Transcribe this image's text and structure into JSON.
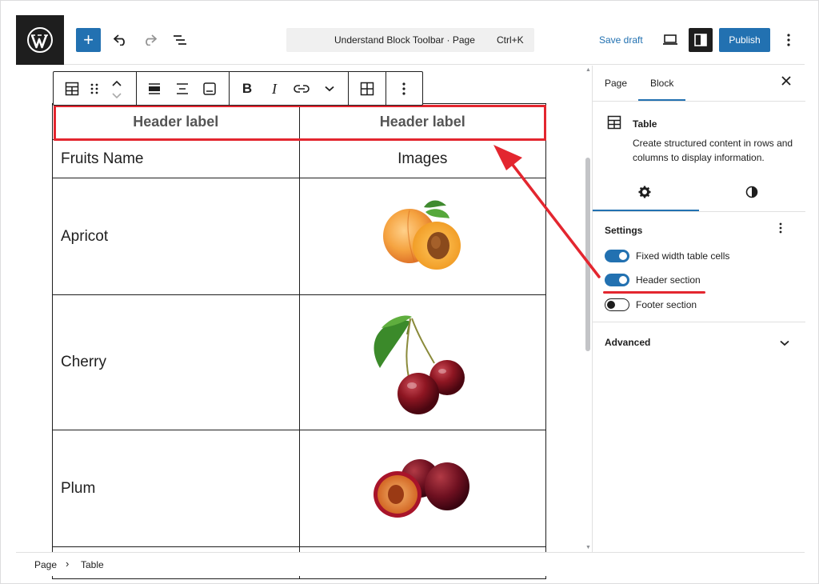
{
  "topbar": {
    "command_title": "Understand Block Toolbar · Page",
    "command_shortcut": "Ctrl+K",
    "save_draft": "Save draft",
    "publish": "Publish",
    "add_symbol": "+"
  },
  "table": {
    "headers": [
      "Header label",
      "Header label"
    ],
    "rows": [
      {
        "name": "Fruits Name",
        "image": "Images",
        "image_icon": ""
      },
      {
        "name": "Apricot",
        "image": "",
        "image_icon": "apricot-image"
      },
      {
        "name": "Cherry",
        "image": "",
        "image_icon": "cherry-image"
      },
      {
        "name": "Plum",
        "image": "",
        "image_icon": "plum-image"
      }
    ]
  },
  "sidebar": {
    "tab_page": "Page",
    "tab_block": "Block",
    "block_name": "Table",
    "block_description": "Create structured content in rows and columns to display information.",
    "settings_title": "Settings",
    "toggles": [
      {
        "label": "Fixed width table cells",
        "on": true
      },
      {
        "label": "Header section",
        "on": true
      },
      {
        "label": "Footer section",
        "on": false
      }
    ],
    "advanced_title": "Advanced"
  },
  "breadcrumb": {
    "items": [
      "Page",
      "Table"
    ],
    "separator": "›"
  },
  "colors": {
    "accent": "#2271b1",
    "annotation": "#e3262f",
    "dark": "#1e1e1e"
  }
}
